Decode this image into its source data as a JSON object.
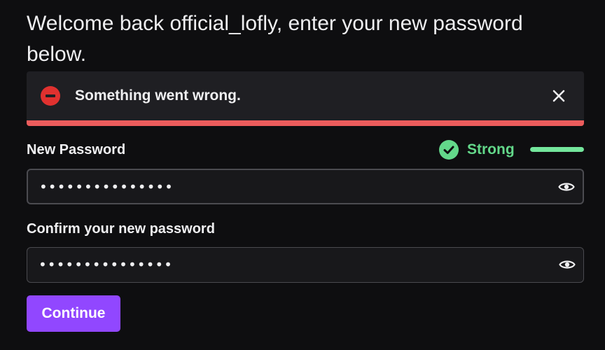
{
  "welcome_text": "Welcome back official_lofly, enter your new password below.",
  "alert": {
    "message": "Something went wrong.",
    "type": "error",
    "icon": "error-minus-icon",
    "close_icon": "close-icon",
    "accent_color": "#eb5c5c"
  },
  "new_password": {
    "label": "New Password",
    "value": "•••••••••••••••",
    "toggle_icon": "eye-icon",
    "strength": {
      "label": "Strong",
      "icon": "check-circle-icon",
      "level": 1.0,
      "color": "#63d88a"
    }
  },
  "confirm_password": {
    "label": "Confirm your new password",
    "value": "•••••••••••••••",
    "toggle_icon": "eye-icon"
  },
  "continue_button": {
    "label": "Continue",
    "color": "#9147ff"
  }
}
